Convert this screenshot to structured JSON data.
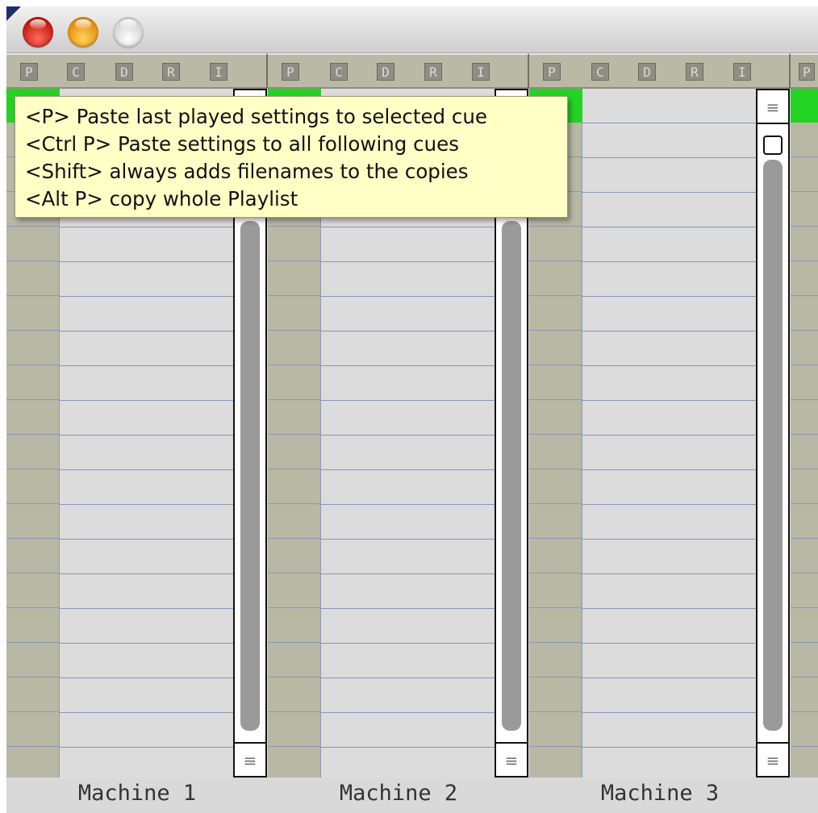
{
  "window": {
    "buttons": [
      "close",
      "minimize",
      "zoom"
    ]
  },
  "columns": [
    {
      "header_buttons": [
        "P",
        "C",
        "D",
        "R",
        "I"
      ],
      "label": "Machine 1"
    },
    {
      "header_buttons": [
        "P",
        "C",
        "D",
        "R",
        "I"
      ],
      "label": "Machine 2"
    },
    {
      "header_buttons": [
        "P",
        "C",
        "D",
        "R",
        "I"
      ],
      "label": "Machine 3"
    },
    {
      "header_buttons": [
        "P"
      ],
      "label": ""
    }
  ],
  "tooltip": {
    "lines": [
      "<P> Paste last played settings to selected cue",
      "<Ctrl P> Paste settings to all following cues",
      "<Shift> always adds filenames to the copies",
      "<Alt P> copy whole Playlist"
    ]
  },
  "colors": {
    "active_cue": "#25d325",
    "header_bg": "#b9b9a6",
    "tooltip_bg": "#ffffc6",
    "row_line": "#8a96b8"
  },
  "icons": {
    "scroll_up": "scroll-up-arrow-icon",
    "scroll_down": "scroll-down-arrow-icon"
  }
}
